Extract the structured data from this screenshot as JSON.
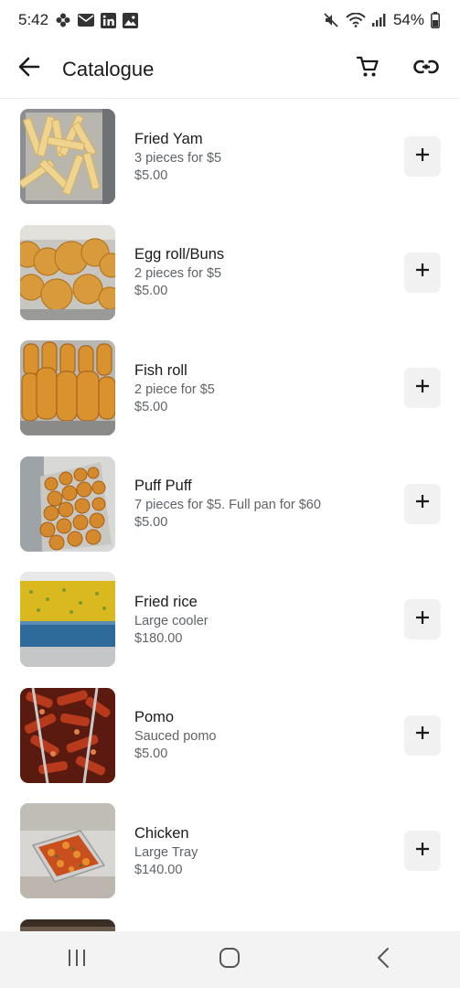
{
  "status_bar": {
    "time": "5:42",
    "battery": "54%",
    "left_icons": [
      "pinwheel-icon",
      "mail-icon",
      "linkedin-icon",
      "gallery-icon"
    ],
    "right_icons": [
      "mute-icon",
      "wifi-icon",
      "signal-icon",
      "battery-icon"
    ]
  },
  "app_bar": {
    "title": "Catalogue",
    "back_icon": "arrow-back-icon",
    "actions": [
      "cart-icon",
      "link-icon"
    ]
  },
  "items": [
    {
      "name": "Fried Yam",
      "description": "3 pieces for $5",
      "price": "$5.00",
      "image": "fried-yam-photo"
    },
    {
      "name": "Egg roll/Buns",
      "description": "2 pieces for $5",
      "price": "$5.00",
      "image": "egg-roll-photo"
    },
    {
      "name": "Fish roll",
      "description": "2 piece for $5",
      "price": "$5.00",
      "image": "fish-roll-photo"
    },
    {
      "name": "Puff Puff",
      "description": "7 pieces for $5. Full pan for $60",
      "price": "$5.00",
      "image": "puff-puff-photo"
    },
    {
      "name": "Fried rice",
      "description": "Large cooler",
      "price": "$180.00",
      "image": "fried-rice-photo"
    },
    {
      "name": "Pomo",
      "description": "Sauced pomo",
      "price": "$5.00",
      "image": "pomo-photo"
    },
    {
      "name": "Chicken",
      "description": "Large Tray",
      "price": "$140.00",
      "image": "chicken-photo"
    }
  ],
  "colors": {
    "text_primary": "#1b1b1b",
    "text_secondary": "#5f6368",
    "button_bg": "#f1f1f1",
    "nav_bg": "#f3f3f3"
  },
  "nav_bar": [
    "recent-apps-icon",
    "home-icon",
    "back-icon"
  ]
}
